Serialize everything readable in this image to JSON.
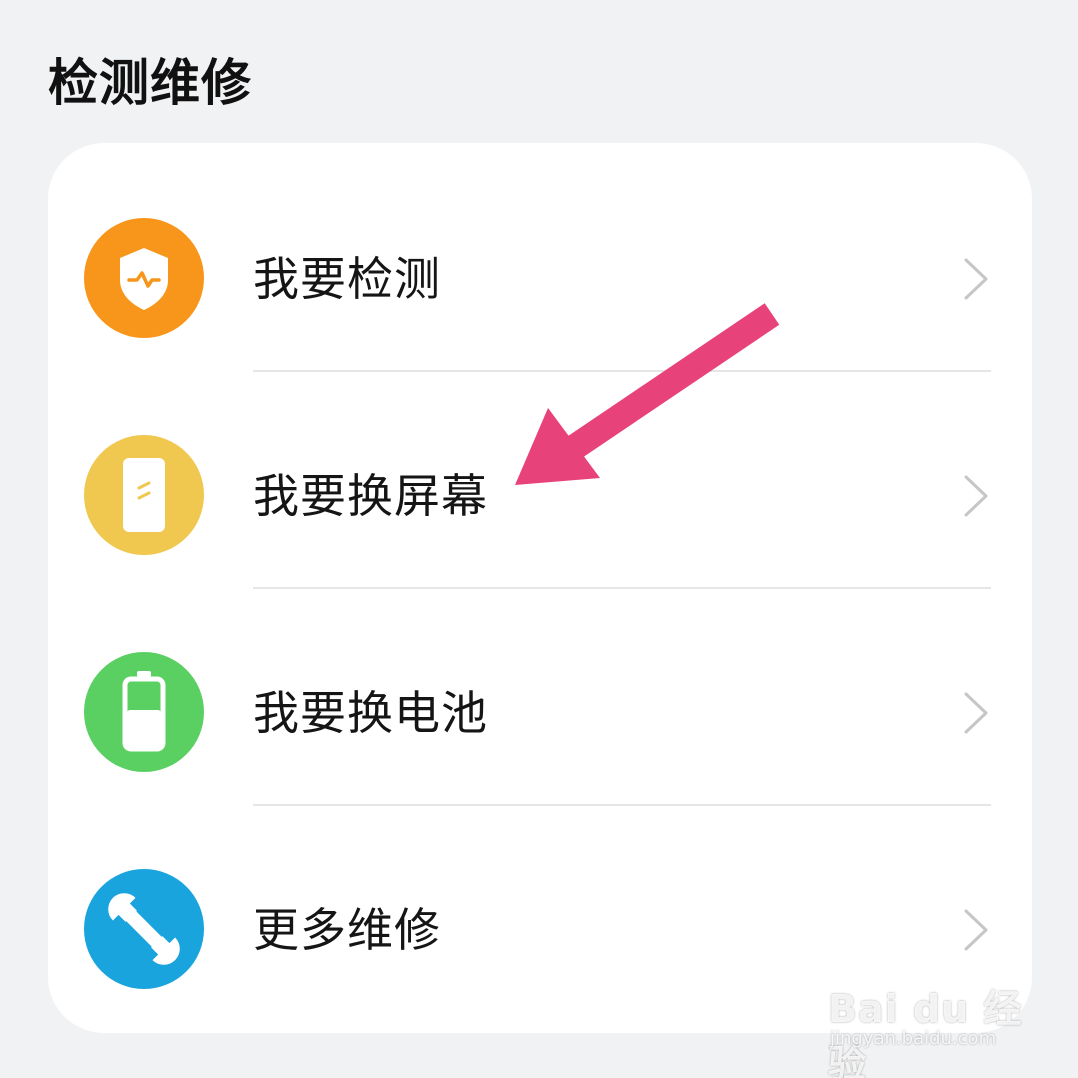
{
  "section": {
    "title": "检测维修"
  },
  "items": [
    {
      "label": "我要检测",
      "icon": "shield-icon",
      "color": "#f7961b"
    },
    {
      "label": "我要换屏幕",
      "icon": "phone-screen-icon",
      "color": "#f0c850"
    },
    {
      "label": "我要换电池",
      "icon": "battery-icon",
      "color": "#5bd062"
    },
    {
      "label": "更多维修",
      "icon": "wrench-icon",
      "color": "#1aa4dd"
    }
  ],
  "annotation": {
    "arrow_color": "#e8427a"
  },
  "watermark": {
    "brand": "Bai du 经验",
    "url": "jingyan.baidu.com"
  }
}
